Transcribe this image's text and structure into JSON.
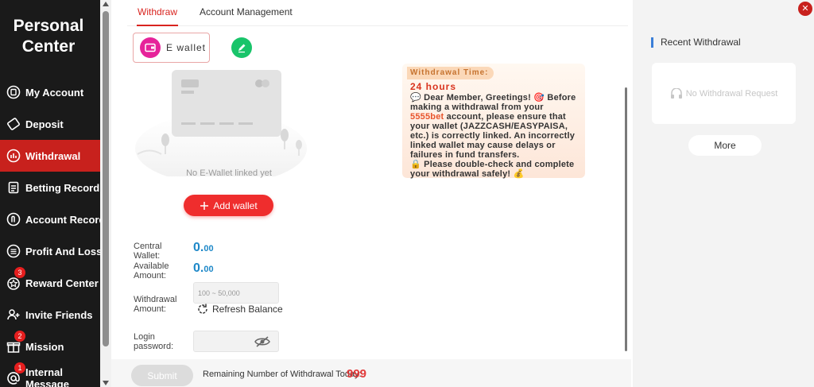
{
  "sidebar": {
    "title": "Personal Center",
    "items": [
      {
        "label": "My Account",
        "icon": "account-icon"
      },
      {
        "label": "Deposit",
        "icon": "deposit-icon"
      },
      {
        "label": "Withdrawal",
        "icon": "withdrawal-icon",
        "active": true
      },
      {
        "label": "Betting Record",
        "icon": "betting-record-icon"
      },
      {
        "label": "Account Record",
        "icon": "account-record-icon"
      },
      {
        "label": "Profit And Loss",
        "icon": "profit-loss-icon"
      },
      {
        "label": "Reward Center",
        "icon": "reward-icon",
        "badge": "3"
      },
      {
        "label": "Invite Friends",
        "icon": "invite-icon"
      },
      {
        "label": "Mission",
        "icon": "gift-icon",
        "badge": "2"
      },
      {
        "label": "Internal Message",
        "icon": "message-icon",
        "badge": "1"
      }
    ]
  },
  "tabs": {
    "withdraw": "Withdraw",
    "account_management": "Account Management"
  },
  "wallet": {
    "ewallet_label": "E wallet",
    "empty_text": "No E-Wallet linked yet",
    "add_wallet_label": "Add wallet"
  },
  "form": {
    "central_wallet_label": "Central Wallet:",
    "central_wallet_int": "0.",
    "central_wallet_dec": "00",
    "available_amount_label": "Available Amount:",
    "available_amount_int": "0.",
    "available_amount_dec": "00",
    "withdrawal_amount_label": "Withdrawal Amount:",
    "withdrawal_amount_placeholder": "100 ~ 50,000",
    "refresh_balance_label": "Refresh Balance",
    "login_password_label": "Login password:",
    "submit_label": "Submit",
    "remaining_label": "Remaining Number of Withdrawal Today:",
    "remaining_count": "999"
  },
  "notice": {
    "title": "Withdrawal Time:",
    "hours": "24 hours",
    "greeting": "Dear Member, Greetings!",
    "body_before_brand": "Before making a withdrawal from your",
    "brand": "5555bet",
    "body_after_brand": "account, please ensure that your wallet (JAZZCASH/EASYPAISA, etc.) is correctly linked. An incorrectly linked wallet may cause delays or failures in fund transfers.",
    "footer": "Please double-check and complete your withdrawal safely!"
  },
  "right_panel": {
    "title": "Recent Withdrawal",
    "no_request": "No Withdrawal Request",
    "more_label": "More"
  },
  "colors": {
    "accent": "#c8211d",
    "amount": "#1e88c8",
    "add_wallet": "#ef2d2d",
    "ewallet_icon": "#e6239a",
    "edit_icon": "#19c46a"
  }
}
